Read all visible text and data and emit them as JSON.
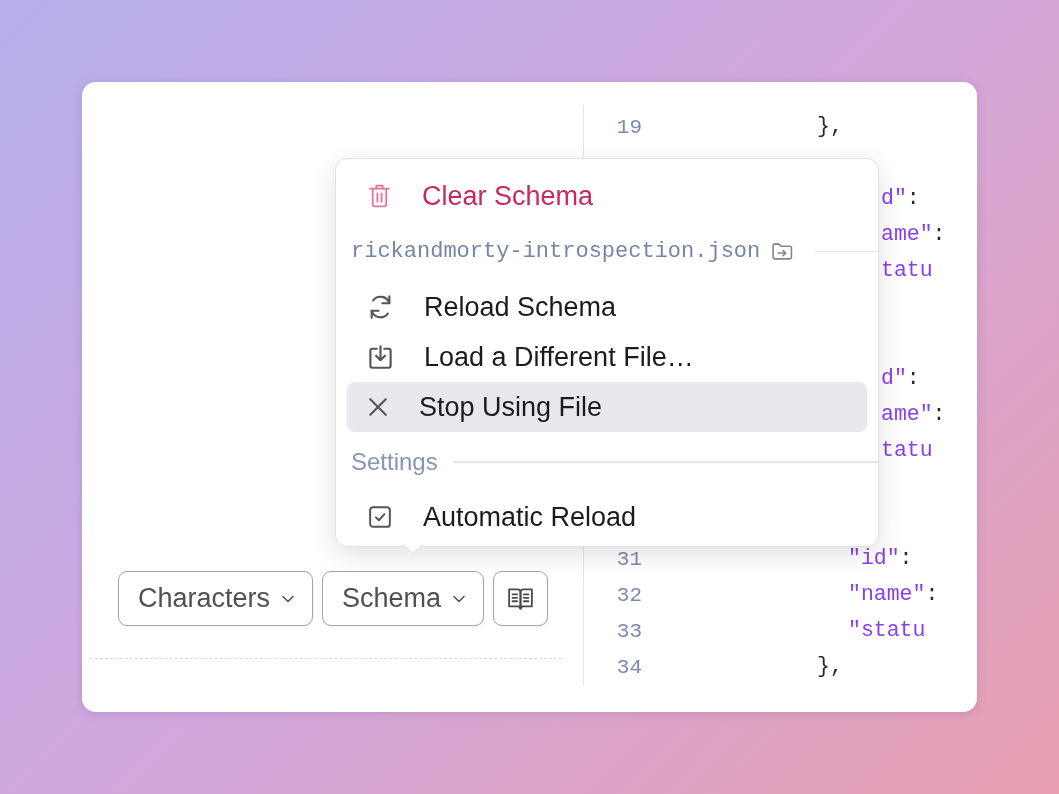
{
  "toolbar": {
    "dropdowns": [
      {
        "label": "Characters"
      },
      {
        "label": "Schema"
      }
    ]
  },
  "schema_menu": {
    "items": [
      {
        "kind": "danger",
        "label": "Clear Schema",
        "selected": false
      },
      {
        "kind": "file_header",
        "label": "rickandmorty-introspection.json"
      },
      {
        "kind": "action",
        "label": "Reload Schema",
        "selected": false
      },
      {
        "kind": "action",
        "label": "Load a Different File…",
        "selected": false
      },
      {
        "kind": "action",
        "label": "Stop Using File",
        "selected": true
      },
      {
        "kind": "section_header",
        "label": "Settings"
      },
      {
        "kind": "toggle",
        "label": "Automatic Reload",
        "checked": true,
        "selected": false
      }
    ]
  },
  "code_view": {
    "lines": [
      {
        "kind": "brace",
        "number": "19",
        "tokens": [
          {
            "kind": "punct",
            "text": "},"
          }
        ]
      },
      {
        "kind": "blank"
      },
      {
        "kind": "tail",
        "tokens": [
          {
            "kind": "key",
            "text": "d\""
          },
          {
            "kind": "punct",
            "text": ":"
          }
        ]
      },
      {
        "kind": "tail",
        "tokens": [
          {
            "kind": "key",
            "text": "ame\""
          },
          {
            "kind": "punct",
            "text": ":"
          }
        ]
      },
      {
        "kind": "tail",
        "tokens": [
          {
            "kind": "key",
            "text": "tatu"
          }
        ]
      },
      {
        "kind": "blank"
      },
      {
        "kind": "blank"
      },
      {
        "kind": "tail",
        "tokens": [
          {
            "kind": "key",
            "text": "d\""
          },
          {
            "kind": "punct",
            "text": ":"
          }
        ]
      },
      {
        "kind": "tail",
        "tokens": [
          {
            "kind": "key",
            "text": "ame\""
          },
          {
            "kind": "punct",
            "text": ":"
          }
        ]
      },
      {
        "kind": "tail",
        "tokens": [
          {
            "kind": "key",
            "text": "tatu"
          }
        ]
      },
      {
        "kind": "blank"
      },
      {
        "kind": "blank"
      },
      {
        "kind": "property",
        "number": "31",
        "tokens": [
          {
            "kind": "key",
            "text": "\"id\""
          },
          {
            "kind": "punct",
            "text": ":"
          }
        ]
      },
      {
        "kind": "property",
        "number": "32",
        "tokens": [
          {
            "kind": "key",
            "text": "\"name\""
          },
          {
            "kind": "punct",
            "text": ":"
          }
        ]
      },
      {
        "kind": "property",
        "number": "33",
        "tokens": [
          {
            "kind": "key",
            "text": "\"statu"
          }
        ]
      },
      {
        "kind": "brace",
        "number": "34",
        "tokens": [
          {
            "kind": "punct",
            "text": "},"
          }
        ]
      }
    ]
  }
}
